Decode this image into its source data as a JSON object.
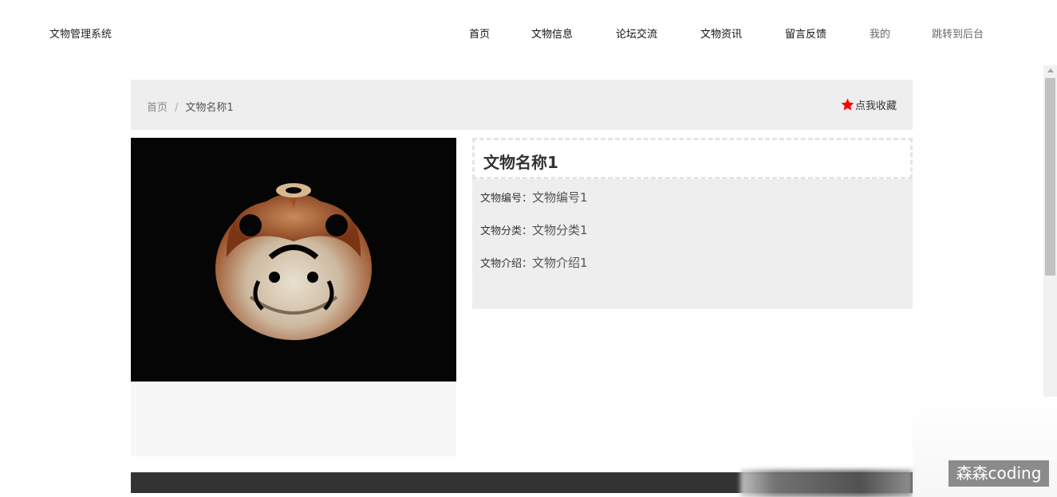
{
  "header": {
    "brand": "文物管理系统",
    "nav": [
      {
        "label": "首页"
      },
      {
        "label": "文物信息"
      },
      {
        "label": "论坛交流"
      },
      {
        "label": "文物资讯"
      },
      {
        "label": "留言反馈"
      },
      {
        "label": "我的"
      },
      {
        "label": "跳转到后台"
      }
    ]
  },
  "breadcrumb": {
    "home": "首页",
    "separator": "/",
    "current": "文物名称1"
  },
  "favorite": {
    "label": "点我收藏",
    "icon": "star-icon",
    "color": "#ff0000"
  },
  "detail": {
    "title": "文物名称1",
    "fields": [
      {
        "label": "文物编号：",
        "value": "文物编号1"
      },
      {
        "label": "文物分类：",
        "value": "文物分类1"
      },
      {
        "label": "文物介绍：",
        "value": "文物介绍1"
      }
    ]
  },
  "watermark": "森森coding"
}
